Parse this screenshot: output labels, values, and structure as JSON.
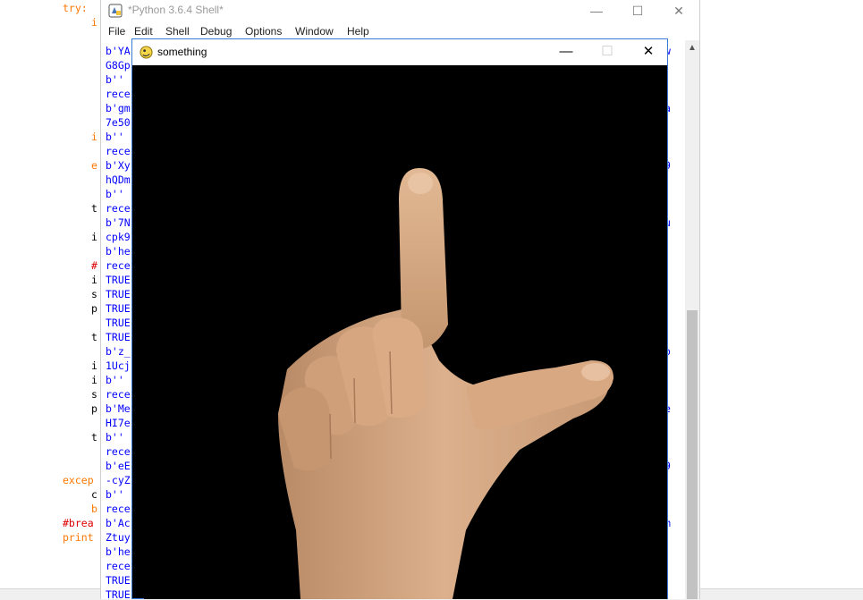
{
  "editor": {
    "lines": [
      {
        "text": "try:",
        "cls": "kw",
        "indent": 70
      },
      {
        "text": "i",
        "cls": "kw",
        "indent": 102
      },
      {
        "text": "i",
        "cls": "kw",
        "indent": 102
      },
      {
        "text": "e",
        "cls": "kw",
        "indent": 102
      },
      {
        "text": "t",
        "cls": "tx",
        "indent": 102
      },
      {
        "text": "i",
        "cls": "tx",
        "indent": 102
      },
      {
        "text": "#",
        "cls": "cm",
        "indent": 102
      },
      {
        "text": "i",
        "cls": "tx",
        "indent": 102
      },
      {
        "text": "s",
        "cls": "tx",
        "indent": 102
      },
      {
        "text": "p",
        "cls": "tx",
        "indent": 102
      },
      {
        "text": "t",
        "cls": "tx",
        "indent": 102
      },
      {
        "text": "i",
        "cls": "tx",
        "indent": 102
      },
      {
        "text": "i",
        "cls": "tx",
        "indent": 102
      },
      {
        "text": "s",
        "cls": "tx",
        "indent": 102
      },
      {
        "text": "p",
        "cls": "tx",
        "indent": 102
      },
      {
        "text": "t",
        "cls": "tx",
        "indent": 102
      },
      {
        "text": "excep",
        "cls": "kw",
        "indent": 70
      },
      {
        "text": "c",
        "cls": "tx",
        "indent": 102
      },
      {
        "text": "b",
        "cls": "kw",
        "indent": 102
      },
      {
        "text": "#brea",
        "cls": "cm",
        "indent": 70
      },
      {
        "text": "print",
        "cls": "kw",
        "indent": 70
      }
    ],
    "rows": [
      0,
      1,
      9,
      11,
      14,
      16,
      18,
      19,
      20,
      21,
      23,
      25,
      26,
      27,
      28,
      30,
      33,
      34,
      35,
      36,
      37
    ]
  },
  "shell": {
    "title": "*Python 3.6.4 Shell*",
    "controls": {
      "minimize": "—",
      "maximize": "☐",
      "close": "✕"
    },
    "menu": [
      "File",
      "Edit",
      "Shell",
      "Debug",
      "Options",
      "Window",
      "Help"
    ],
    "output": [
      "b'YA",
      "G8Gp",
      "b''",
      "rece",
      "b'gm",
      "7e50",
      "b''",
      "rece",
      "b'Xy",
      "hQDm",
      "b''",
      "rece",
      "b'7N",
      "cpk9",
      "b'he",
      "rece",
      "TRUE",
      "TRUE",
      "TRUE",
      "TRUE",
      "TRUE",
      "b'z_",
      "1Ucj",
      "b''",
      "rece",
      "b'Me",
      "HI7e",
      "b''",
      "rece",
      "b'eE",
      "-cyZ",
      "b''",
      "rece",
      "b'Ac",
      "Ztuy",
      "b'he",
      "rece",
      "TRUE",
      "TRUE"
    ],
    "right_output": [
      {
        "text": "w",
        "row": 0
      },
      {
        "text": "a",
        "row": 4
      },
      {
        "text": "9",
        "row": 8
      },
      {
        "text": "u",
        "row": 12
      },
      {
        "text": "o",
        "row": 21
      },
      {
        "text": "e",
        "row": 25
      },
      {
        "text": "9",
        "row": 29
      },
      {
        "text": "m",
        "row": 33
      }
    ]
  },
  "popup": {
    "title": "something",
    "controls": {
      "minimize": "—",
      "maximize": "☐",
      "close": "✕"
    },
    "image_subject": "hand showing L sign"
  },
  "colors": {
    "output_blue": "#0000ff",
    "keyword_orange": "#ff7700",
    "comment_red": "#dd0000",
    "popup_border": "#3a7bd5"
  }
}
